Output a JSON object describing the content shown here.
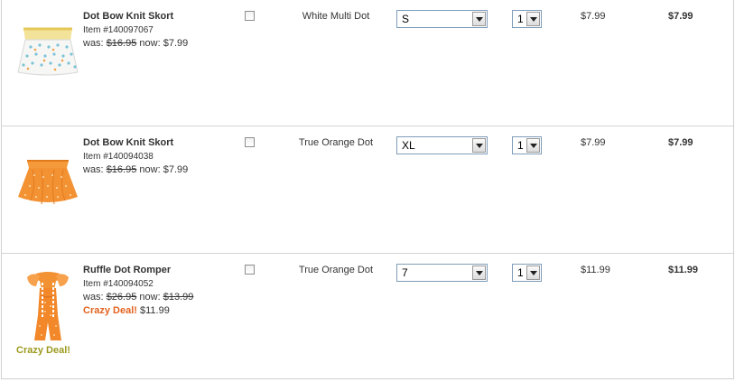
{
  "rows": [
    {
      "name": "Dot Bow Knit Skort",
      "item": "Item #140097067",
      "was_label": "was:",
      "was_price": "$16.95",
      "now_label": "now:",
      "now_price": "$7.99",
      "color": "White Multi Dot",
      "size": "S",
      "qty": "1",
      "price": "$7.99",
      "total": "$7.99"
    },
    {
      "name": "Dot Bow Knit Skort",
      "item": "Item #140094038",
      "was_label": "was:",
      "was_price": "$16.95",
      "now_label": "now:",
      "now_price": "$7.99",
      "color": "True Orange Dot",
      "size": "XL",
      "qty": "1",
      "price": "$7.99",
      "total": "$7.99"
    },
    {
      "name": "Ruffle Dot Romper",
      "item": "Item #140094052",
      "was_label": "was:",
      "was_price": "$26.95",
      "now_label": "now:",
      "now_price": "$13.99",
      "deal_label": "Crazy Deal!",
      "deal_price": "$11.99",
      "image_badge": "Crazy Deal!",
      "color": "True Orange Dot",
      "size": "7",
      "qty": "1",
      "price": "$11.99",
      "total": "$11.99"
    }
  ],
  "colors": {
    "orange": "#f08a2c",
    "deal_text": "#e2631f",
    "badge_text": "#9c9a1d",
    "border": "#d4d4d4"
  }
}
